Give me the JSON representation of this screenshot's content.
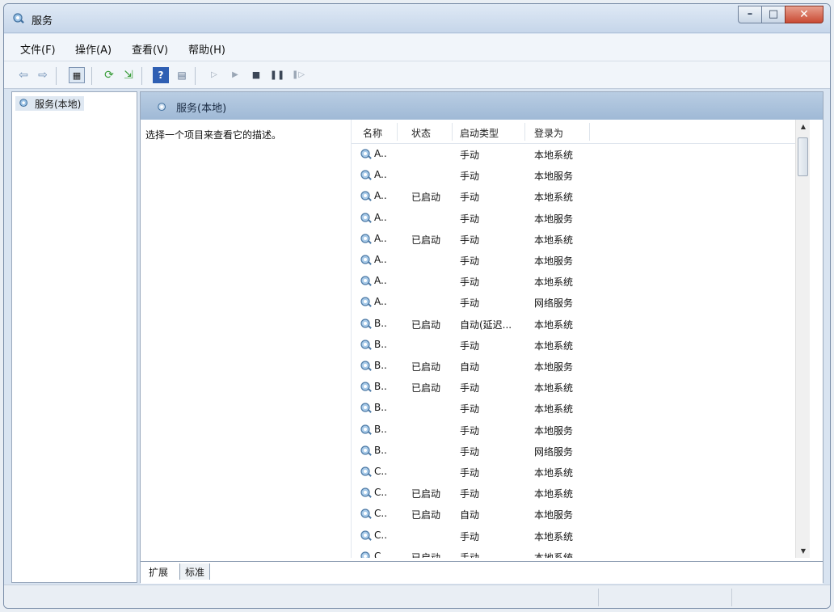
{
  "window": {
    "title": "服务"
  },
  "menu": [
    "文件(F)",
    "操作(A)",
    "查看(V)",
    "帮助(H)"
  ],
  "tree": {
    "root": "服务(本地)"
  },
  "panel": {
    "header": "服务(本地)",
    "description": "选择一个项目来查看它的描述。"
  },
  "list": {
    "columns": [
      "名称",
      "状态",
      "启动类型",
      "登录为"
    ],
    "rows": [
      {
        "name": "A..",
        "status": "",
        "startup": "手动",
        "logon": "本地系统"
      },
      {
        "name": "A..",
        "status": "",
        "startup": "手动",
        "logon": "本地服务"
      },
      {
        "name": "A..",
        "status": "已启动",
        "startup": "手动",
        "logon": "本地系统"
      },
      {
        "name": "A..",
        "status": "",
        "startup": "手动",
        "logon": "本地服务"
      },
      {
        "name": "A..",
        "status": "已启动",
        "startup": "手动",
        "logon": "本地系统"
      },
      {
        "name": "A..",
        "status": "",
        "startup": "手动",
        "logon": "本地服务"
      },
      {
        "name": "A..",
        "status": "",
        "startup": "手动",
        "logon": "本地系统"
      },
      {
        "name": "A..",
        "status": "",
        "startup": "手动",
        "logon": "网络服务"
      },
      {
        "name": "B..",
        "status": "已启动",
        "startup": "自动(延迟...",
        "logon": "本地系统"
      },
      {
        "name": "B..",
        "status": "",
        "startup": "手动",
        "logon": "本地系统"
      },
      {
        "name": "B..",
        "status": "已启动",
        "startup": "自动",
        "logon": "本地服务"
      },
      {
        "name": "B..",
        "status": "已启动",
        "startup": "手动",
        "logon": "本地系统"
      },
      {
        "name": "B..",
        "status": "",
        "startup": "手动",
        "logon": "本地系统"
      },
      {
        "name": "B..",
        "status": "",
        "startup": "手动",
        "logon": "本地服务"
      },
      {
        "name": "B..",
        "status": "",
        "startup": "手动",
        "logon": "网络服务"
      },
      {
        "name": "C..",
        "status": "",
        "startup": "手动",
        "logon": "本地系统"
      },
      {
        "name": "C..",
        "status": "已启动",
        "startup": "手动",
        "logon": "本地系统"
      },
      {
        "name": "C..",
        "status": "已启动",
        "startup": "自动",
        "logon": "本地服务"
      },
      {
        "name": "C..",
        "status": "",
        "startup": "手动",
        "logon": "本地系统"
      },
      {
        "name": "C..",
        "status": "已启动",
        "startup": "手动",
        "logon": "本地系统"
      }
    ]
  },
  "tabs": [
    "扩展",
    "标准"
  ]
}
